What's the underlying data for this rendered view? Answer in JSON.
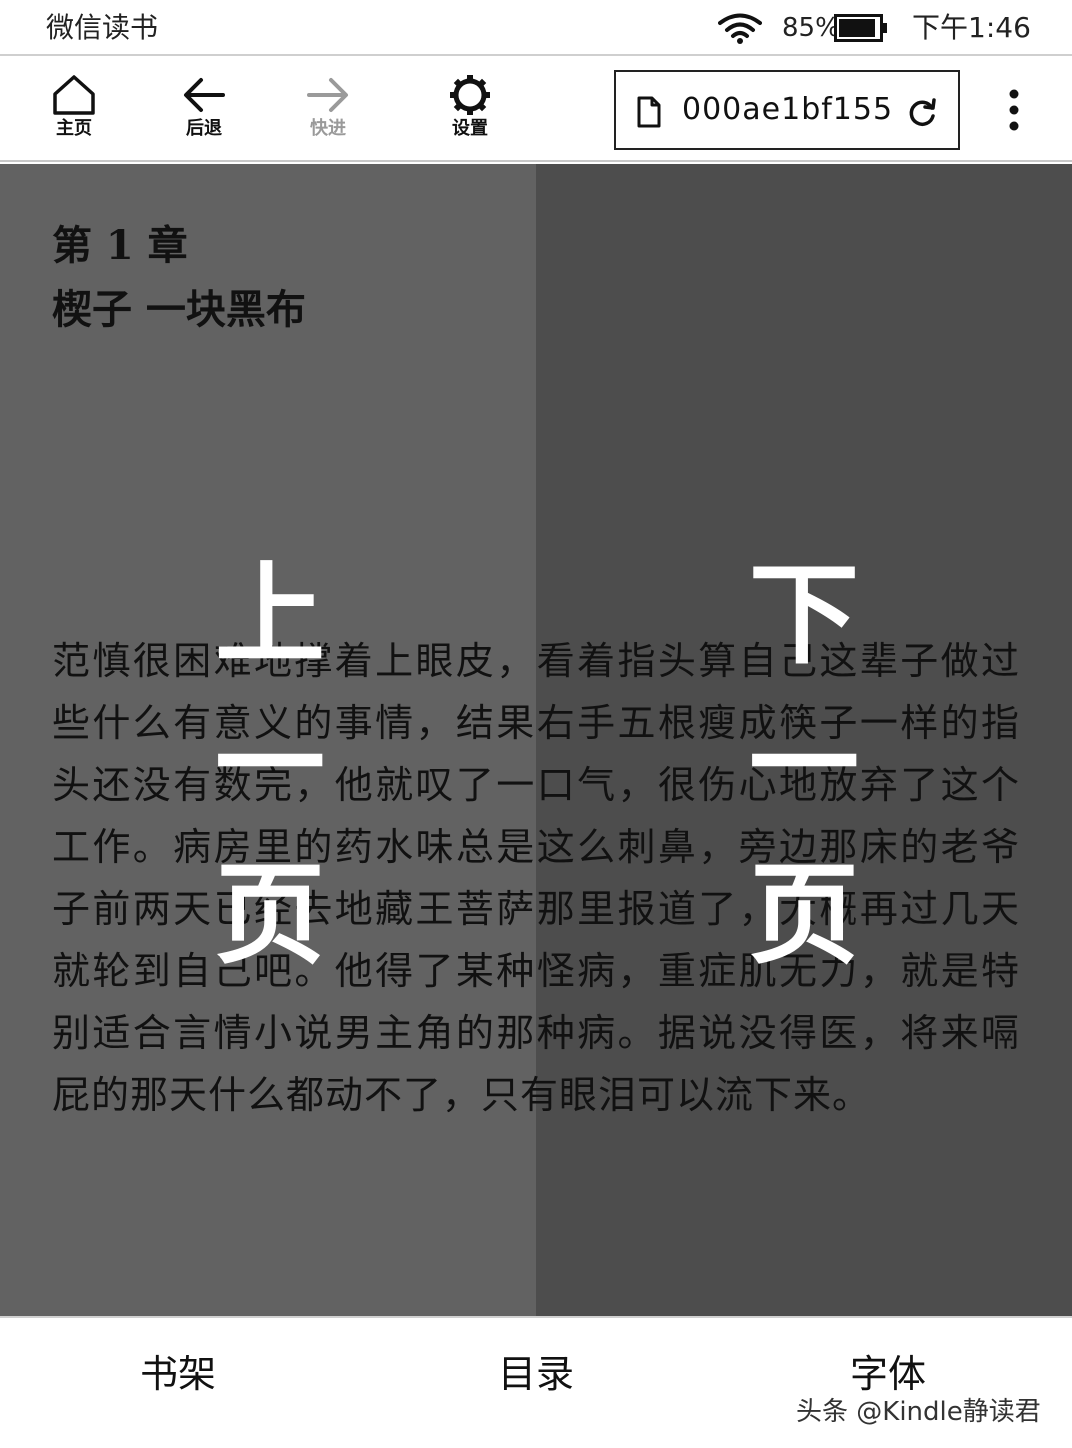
{
  "status_bar": {
    "app_name": "微信读书",
    "battery_percent": "85%",
    "time": "下午1:46",
    "icons": [
      "wifi-icon",
      "battery-icon"
    ]
  },
  "toolbar": {
    "home_label": "主页",
    "back_label": "后退",
    "forward_label": "快进",
    "settings_label": "设置",
    "address_text": "000ae1bf155",
    "icons": [
      "home-icon",
      "back-arrow-icon",
      "forward-arrow-icon",
      "gear-icon",
      "document-icon",
      "reload-icon",
      "more-vertical-icon"
    ]
  },
  "reader": {
    "chapter_number": "第 1 章",
    "chapter_title": "楔子 一块黑布",
    "prev_page_label": "上一页",
    "next_page_label": "下一页",
    "body_text": "范慎很困难地撑着上眼皮，看着指头算自己这辈子做过些什么有意义的事情，结果右手五根瘦成筷子一样的指头还没有数完，他就叹了一口气，很伤心地放弃了这个工作。病房里的药水味总是这么刺鼻，旁边那床的老爷子前两天已经去地藏王菩萨那里报道了，大概再过几天就轮到自己吧。他得了某种怪病，重症肌无力，就是特别适合言情小说男主角的那种病。据说没得医，将来嗝屁的那天什么都动不了，只有眼泪可以流下来。"
  },
  "bottom_bar": {
    "shelf_label": "书架",
    "toc_label": "目录",
    "font_label": "字体",
    "watermark": "头条 @Kindle静读君"
  }
}
